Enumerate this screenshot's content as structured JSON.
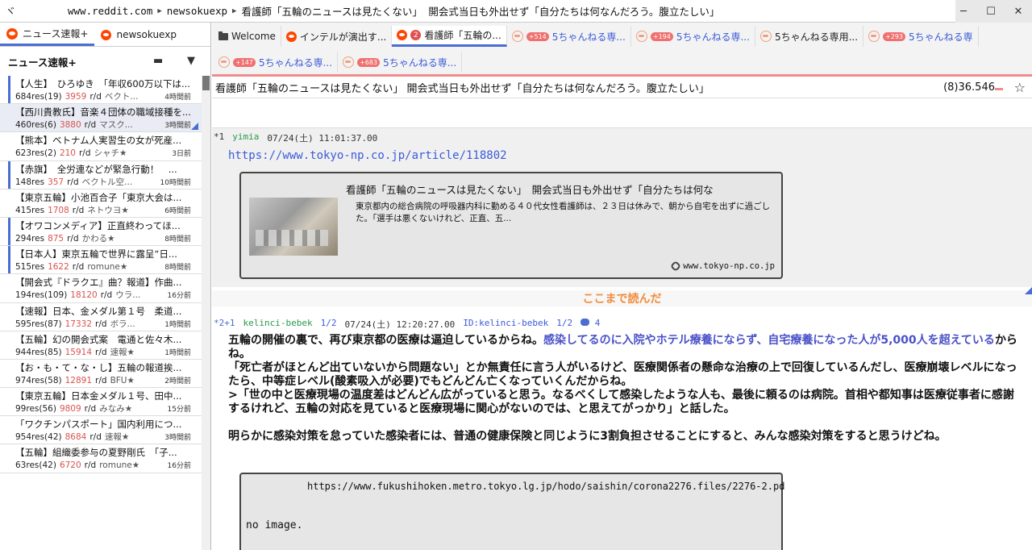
{
  "titlebar": {
    "logo": "ヾ",
    "url_parts": [
      "www.reddit.com",
      "newsokuexp",
      "看護師「五輪のニュースは見たくない」 開会式当日も外出せず「自分たちは何なんだろう。腹立たしい」"
    ],
    "controls": [
      "─",
      "☐",
      "✕"
    ]
  },
  "left": {
    "tabs": [
      {
        "label": "ニュース速報+",
        "active": true
      },
      {
        "label": "newsokuexp",
        "active": false
      }
    ],
    "header": "ニュース速報+",
    "items": [
      {
        "title": "【人生】　ひろゆき　「年収600万以下は...",
        "res": "684res(19)",
        "num": "3959",
        "rd": "r/d",
        "by": "ベクト...",
        "time": "4時間前",
        "mark": true,
        "sel": false
      },
      {
        "title": "【西川貴教氏】音楽４団体の職域接種を...",
        "res": "460res(6)",
        "num": "3880",
        "rd": "r/d",
        "by": "マスク...",
        "time": "3時間前",
        "mark": false,
        "sel": true
      },
      {
        "title": "【熊本】ベトナム人実習生の女が死産...",
        "res": "623res(2)",
        "num": "210",
        "rd": "r/d",
        "by": "シャチ★",
        "time": "3日前",
        "mark": false,
        "sel": false
      },
      {
        "title": "【赤旗】　全労連などが緊急行動！　...",
        "res": "148res",
        "num": "357",
        "rd": "r/d",
        "by": "ベクトル空...",
        "time": "10時間前",
        "mark": true,
        "sel": false
      },
      {
        "title": "【東京五輪】小池百合子「東京大会は...",
        "res": "415res",
        "num": "1708",
        "rd": "r/d",
        "by": "ネトウヨ★",
        "time": "6時間前",
        "mark": false,
        "sel": false
      },
      {
        "title": "【オワコンメディア】正直終わってほ...",
        "res": "294res",
        "num": "875",
        "rd": "r/d",
        "by": "かわる★",
        "time": "8時間前",
        "mark": true,
        "sel": false
      },
      {
        "title": "【日本人】東京五輪で世界に露呈“日...",
        "res": "515res",
        "num": "1622",
        "rd": "r/d",
        "by": "romune★",
        "time": "8時間前",
        "mark": true,
        "sel": false
      },
      {
        "title": "【開会式『ドラクエ』曲？報道】作曲...",
        "res": "194res(109)",
        "num": "18120",
        "rd": "r/d",
        "by": "ウラ...",
        "time": "16分前",
        "mark": false,
        "sel": false
      },
      {
        "title": "【速報】日本、金メダル第１号　柔道...",
        "res": "595res(87)",
        "num": "17332",
        "rd": "r/d",
        "by": "ボラ...",
        "time": "1時間前",
        "mark": false,
        "sel": false
      },
      {
        "title": "【五輪】幻の開会式案　電通と佐々木...",
        "res": "944res(85)",
        "num": "15914",
        "rd": "r/d",
        "by": "速報★",
        "time": "1時間前",
        "mark": false,
        "sel": false
      },
      {
        "title": "【お・も・て・な・し】五輪の報道挨...",
        "res": "974res(58)",
        "num": "12891",
        "rd": "r/d",
        "by": "BFU★",
        "time": "2時間前",
        "mark": false,
        "sel": false
      },
      {
        "title": "【東京五輪】日本金メダル１号、田中...",
        "res": "99res(56)",
        "num": "9809",
        "rd": "r/d",
        "by": "みなみ★",
        "time": "15分前",
        "mark": false,
        "sel": false
      },
      {
        "title": "「ワクチンパスポート」国内利用につ...",
        "res": "954res(42)",
        "num": "8684",
        "rd": "r/d",
        "by": "速報★",
        "time": "3時間前",
        "mark": false,
        "sel": false
      },
      {
        "title": "【五輪】組織委参与の夏野剛氏　「子...",
        "res": "63res(42)",
        "num": "6720",
        "rd": "r/d",
        "by": "romune★",
        "time": "16分前",
        "mark": false,
        "sel": false
      }
    ]
  },
  "tabs": {
    "row1": [
      {
        "label": "Welcome",
        "icon": "folder-icon",
        "badge": "",
        "active": false,
        "blue": false
      },
      {
        "label": "インテルが演出す...",
        "icon": "reddit-icon",
        "badge": "",
        "active": false,
        "blue": false
      },
      {
        "label": "看護師「五輪の...",
        "icon": "reddit-icon",
        "badge": "2",
        "active": true,
        "blue": false
      },
      {
        "label": "5ちゃんねる専...",
        "icon": "thread-icon",
        "badge": "+514",
        "active": false,
        "blue": true
      },
      {
        "label": "5ちゃんねる専...",
        "icon": "thread-icon",
        "badge": "+194",
        "active": false,
        "blue": true
      },
      {
        "label": "5ちゃんねる専用...",
        "icon": "thread-icon",
        "badge": "",
        "active": false,
        "blue": false
      },
      {
        "label": "5ちゃんねる専",
        "icon": "thread-icon",
        "badge": "+293",
        "active": false,
        "blue": true
      }
    ],
    "row2": [
      {
        "label": "5ちゃんねる専...",
        "icon": "thread-icon",
        "badge": "+147",
        "active": false,
        "blue": true
      },
      {
        "label": "5ちゃんねる専...",
        "icon": "thread-icon",
        "badge": "+683",
        "active": false,
        "blue": true
      }
    ]
  },
  "thread": {
    "title": "看護師「五輪のニュースは見たくない」 開会式当日も外出せず「自分たちは何なんだろう。腹立たしい」",
    "count": "(8)36.546",
    "star": "☆"
  },
  "post1": {
    "no": "*1",
    "name": "yimia",
    "date": "07/24(土) 11:01:37.00",
    "link": "https://www.tokyo-np.co.jp/article/118802",
    "card": {
      "title": "看護師「五輪のニュースは見たくない」　開会式当日も外出せず「自分たちは何な",
      "desc": "東京都内の総合病院の呼吸器内科に勤める４０代女性看護師は、２３日は休みで、朝から自宅を出ずに過ごした。「選手は悪くないけれど、正直、五...",
      "domain": "www.tokyo-np.co.jp"
    }
  },
  "readhere": "ここまで読んだ",
  "post2": {
    "no": "*2+1",
    "name": "kelinci-bebek",
    "frac1": "1/2",
    "date": "07/24(土) 12:20:27.00",
    "id": "ID:kelinci-bebek",
    "frac2": "1/2",
    "replies": "4",
    "line1a": "五輪の開催の裏で、再び東京都の医療は逼迫しているからね。",
    "line1b": "感染してるのに入院やホテル療養にならず、自宅療養になった人が5,000人を超えている",
    "line1c": "からね。",
    "line2": "「死亡者がほとんど出ていないから問題ない」とか無責任に言う人がいるけど、医療関係者の懸命な治療の上で回復しているんだし、医療崩壊レベルになったら、中等症レベル(酸素吸入が必要)でもどんどん亡くなっていくんだからね。",
    "line3": ">「世の中と医療現場の温度差はどんどん広がっていると思う。なるべくして感染したような人も、最後に頼るのは病院。首相や都知事は医療従事者に感謝するけれど、五輪の対応を見ていると医療現場に関心がないのでは、と思えてがっかり」と話した。",
    "line4": "明らかに感染対策を怠っていた感染者には、普通の健康保険と同じように3割負担させることにすると、みんな感染対策をすると思うけどね。",
    "card": {
      "url": "https://www.fukushihoken.metro.tokyo.lg.jp/hodo/saishin/corona2276.files/2276-2.pd",
      "noimage": "no image."
    }
  }
}
